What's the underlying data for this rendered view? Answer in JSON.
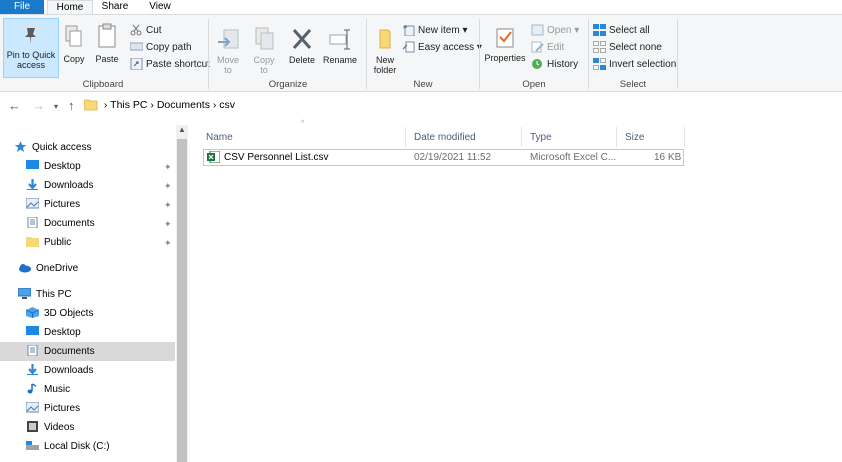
{
  "tabs": [
    {
      "label": "File"
    },
    {
      "label": "Home"
    },
    {
      "label": "Share"
    },
    {
      "label": "View"
    }
  ],
  "ribbon": {
    "clipboard": {
      "group_label": "Clipboard",
      "pin_label": "Pin to Quick access",
      "copy_label": "Copy",
      "paste_label": "Paste",
      "cut_label": "Cut",
      "copy_path_label": "Copy path",
      "paste_shortcut_label": "Paste shortcut"
    },
    "organize": {
      "group_label": "Organize",
      "move_label": "Move to",
      "copy_to_label": "Copy to",
      "delete_label": "Delete",
      "rename_label": "Rename"
    },
    "new": {
      "group_label": "New",
      "new_folder_label": "New folder",
      "new_item_label": "New item ▾",
      "easy_access_label": "Easy access ▾"
    },
    "open": {
      "group_label": "Open",
      "properties_label": "Properties",
      "open_label": "Open ▾",
      "edit_label": "Edit",
      "history_label": "History"
    },
    "select": {
      "group_label": "Select",
      "select_all_label": "Select all",
      "select_none_label": "Select none",
      "invert_label": "Invert selection"
    }
  },
  "address": {
    "segments": [
      "This PC",
      "Documents",
      "csv"
    ]
  },
  "sidebar": {
    "quick_access": "Quick access",
    "quick_items": [
      {
        "label": "Desktop"
      },
      {
        "label": "Downloads"
      },
      {
        "label": "Pictures"
      },
      {
        "label": "Documents"
      },
      {
        "label": "Public"
      }
    ],
    "onedrive": "OneDrive",
    "this_pc": "This PC",
    "pc_items": [
      {
        "label": "3D Objects"
      },
      {
        "label": "Desktop"
      },
      {
        "label": "Documents"
      },
      {
        "label": "Downloads"
      },
      {
        "label": "Music"
      },
      {
        "label": "Pictures"
      },
      {
        "label": "Videos"
      },
      {
        "label": "Local Disk (C:)"
      }
    ]
  },
  "columns": {
    "name": "Name",
    "date": "Date modified",
    "type": "Type",
    "size": "Size"
  },
  "files": [
    {
      "name": "CSV Personnel List.csv",
      "date": "02/19/2021 11:52",
      "type": "Microsoft Excel C...",
      "size": "16 KB"
    }
  ],
  "colors": {
    "file_tab": "#1979ca",
    "selection": "#d9d9d9",
    "folder": "#f8d775"
  }
}
